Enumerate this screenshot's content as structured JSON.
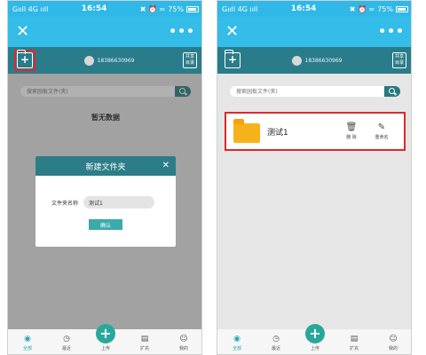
{
  "status_bar": {
    "carrier": "Gııll 4G ııll",
    "time": "16:54",
    "icons": "✖ ⏰ ≈",
    "battery": "75%"
  },
  "header": {
    "close_icon": "✕",
    "more_icon": "•••"
  },
  "toolbar": {
    "new_folder_icon": "+",
    "phone": "18386630969",
    "share_label_1": "共享",
    "share_label_2": "目录"
  },
  "search": {
    "placeholder": "搜索园板文件(夹)"
  },
  "empty_message": "暂无数据",
  "dialog": {
    "title": "新建文件夹",
    "close": "✕",
    "field_label": "文件夹名称",
    "field_value": "测试1",
    "confirm_label": "确认"
  },
  "file_item": {
    "name": "测试1",
    "delete_label": "删 除",
    "rename_label": "重命名",
    "delete_icon": "Ὕ1",
    "rename_icon": "✎"
  },
  "bottom_nav": {
    "items": [
      {
        "label": "全部",
        "icon": "◉"
      },
      {
        "label": "最近",
        "icon": "◷"
      },
      {
        "label": "上传",
        "icon": "+"
      },
      {
        "label": "扩充",
        "icon": "▤"
      },
      {
        "label": "我的",
        "icon": "☺"
      }
    ]
  },
  "colors": {
    "header": "#33bde8",
    "toolbar": "#2a7c8a",
    "accent": "#28a89a",
    "highlight": "#e02828",
    "folder": "#f7b21b"
  }
}
